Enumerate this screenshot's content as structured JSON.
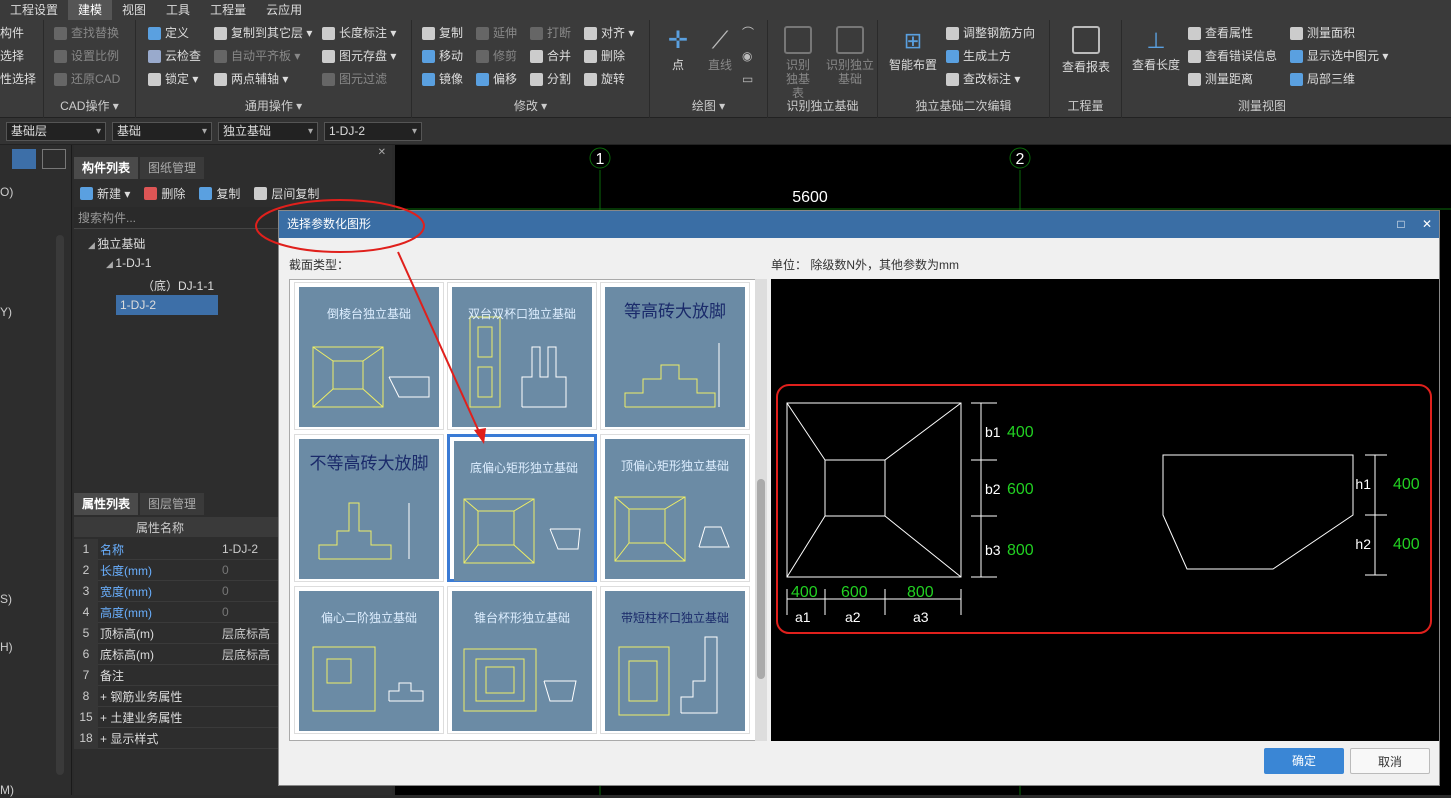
{
  "menubar": {
    "items": [
      "工程设置",
      "建模",
      "视图",
      "工具",
      "工程量",
      "云应用"
    ],
    "active": 1
  },
  "ribbon": {
    "cad": {
      "items": [
        "查找替换",
        "设置比例",
        "还原CAD"
      ],
      "left_items": [
        "构件",
        "选择",
        "性选择"
      ],
      "label": "CAD操作 ▾"
    },
    "general": {
      "items": [
        "定义",
        "云检查",
        "锁定 ▾",
        "复制到其它层 ▾",
        "自动平齐板 ▾",
        "两点辅轴 ▾",
        "长度标注 ▾",
        "图元存盘 ▾",
        "图元过滤"
      ],
      "label": "通用操作 ▾"
    },
    "modify": {
      "items": [
        "复制",
        "移动",
        "镜像",
        "延伸",
        "修剪",
        "偏移",
        "打断",
        "合并",
        "分割",
        "对齐 ▾",
        "删除",
        "旋转"
      ],
      "label": "修改 ▾"
    },
    "draw": {
      "items": [
        "点",
        "直线"
      ],
      "label": "绘图 ▾"
    },
    "identify": {
      "items": [
        "识别独基表",
        "识别独立基础"
      ],
      "label": "识别独立基础"
    },
    "edit2": {
      "big": "智能布置",
      "items": [
        "调整钢筋方向",
        "生成土方",
        "查改标注 ▾"
      ],
      "label": "独立基础二次编辑"
    },
    "quantity": {
      "big": "查看报表",
      "label": "工程量"
    },
    "measure": {
      "big": "查看长度",
      "items": [
        "查看属性",
        "查看错误信息",
        "测量距离",
        "测量面积",
        "显示选中图元 ▾",
        "局部三维"
      ],
      "label": "测量视图"
    }
  },
  "combos": [
    "基础层",
    "基础",
    "独立基础",
    "1-DJ-2"
  ],
  "left_strip": [
    "O)",
    "Y)",
    "S)",
    "H)",
    "M)"
  ],
  "component_list": {
    "tabs": [
      "构件列表",
      "图纸管理"
    ],
    "toolbar": [
      "新建 ▾",
      "删除",
      "复制",
      "层间复制"
    ],
    "search_placeholder": "搜索构件...",
    "tree": [
      "独立基础",
      "1-DJ-1",
      "（底）DJ-1-1",
      "1-DJ-2"
    ]
  },
  "property_list": {
    "tabs": [
      "属性列表",
      "图层管理"
    ],
    "headers": [
      "属性名称",
      "属"
    ],
    "rows": [
      {
        "n": "1",
        "k": "名称",
        "v": "1-DJ-2",
        "blue": true
      },
      {
        "n": "2",
        "k": "长度(mm)",
        "v": "0",
        "blue": true
      },
      {
        "n": "3",
        "k": "宽度(mm)",
        "v": "0",
        "blue": true
      },
      {
        "n": "4",
        "k": "高度(mm)",
        "v": "0",
        "blue": true
      },
      {
        "n": "5",
        "k": "顶标高(m)",
        "v": "层底标高",
        "blue": false
      },
      {
        "n": "6",
        "k": "底标高(m)",
        "v": "层底标高",
        "blue": false
      },
      {
        "n": "7",
        "k": "备注",
        "v": "",
        "blue": false
      },
      {
        "n": "8",
        "k": "+ 钢筋业务属性",
        "v": "",
        "blue": false
      },
      {
        "n": "15",
        "k": "+ 土建业务属性",
        "v": "",
        "blue": false
      },
      {
        "n": "18",
        "k": "+ 显示样式",
        "v": "",
        "blue": false
      }
    ]
  },
  "canvas": {
    "axis1": "1",
    "axis2": "2",
    "dim": "5600"
  },
  "dialog": {
    "title": "选择参数化图形",
    "section_label": "截面类型：",
    "unit_label": "单位：  除级数N外，其他参数为mm",
    "shapes": [
      "倒棱台独立基础",
      "双台双杯口独立基础",
      "等高砖大放脚",
      "不等高砖大放脚",
      "底偏心矩形独立基础",
      "顶偏心矩形独立基础",
      "偏心二阶独立基础",
      "锥台杯形独立基础",
      "带短柱杯口独立基础"
    ],
    "selected": 4,
    "preview": {
      "b1": "400",
      "b2": "600",
      "b3": "800",
      "a1": "400",
      "a2": "600",
      "a3": "800",
      "h1": "400",
      "h2": "400",
      "labels": [
        "b1",
        "b2",
        "b3",
        "a1",
        "a2",
        "a3",
        "h1",
        "h2"
      ]
    },
    "ok": "确定",
    "cancel": "取消"
  },
  "colors": {
    "accent": "#3a86d5",
    "annotation": "#e0201c",
    "green": "#22d022"
  }
}
